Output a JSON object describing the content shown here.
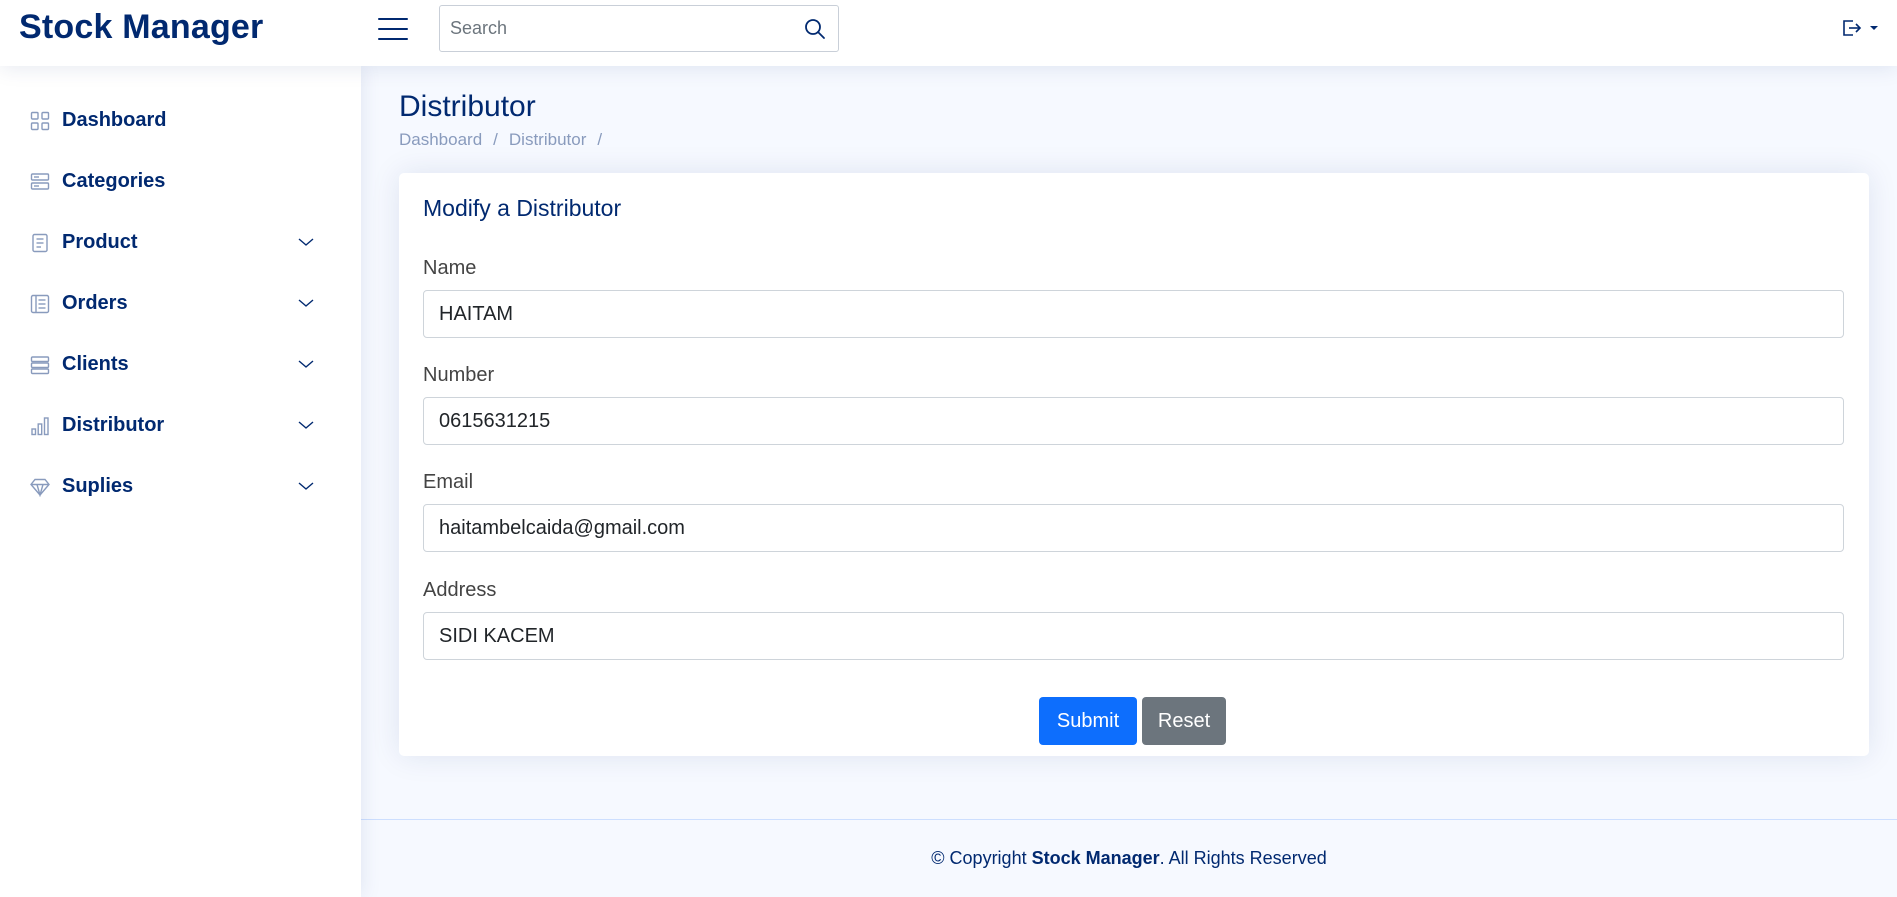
{
  "header": {
    "logo": "Stock Manager",
    "search_placeholder": "Search"
  },
  "sidebar": {
    "items": [
      {
        "label": "Dashboard",
        "icon": "grid-icon",
        "has_chevron": false
      },
      {
        "label": "Categories",
        "icon": "stack-icon",
        "has_chevron": false
      },
      {
        "label": "Product",
        "icon": "journal-icon",
        "has_chevron": true
      },
      {
        "label": "Orders",
        "icon": "layout-text-icon",
        "has_chevron": true
      },
      {
        "label": "Clients",
        "icon": "server-icon",
        "has_chevron": true
      },
      {
        "label": "Distributor",
        "icon": "bar-chart-icon",
        "has_chevron": true
      },
      {
        "label": "Suplies",
        "icon": "gem-icon",
        "has_chevron": true
      }
    ]
  },
  "page": {
    "title": "Distributor",
    "breadcrumb": [
      "Dashboard",
      "Distributor"
    ]
  },
  "form": {
    "title": "Modify a Distributor",
    "fields": [
      {
        "label": "Name",
        "value": "HAITAM"
      },
      {
        "label": "Number",
        "value": "0615631215"
      },
      {
        "label": "Email",
        "value": "haitambelcaida@gmail.com"
      },
      {
        "label": "Address",
        "value": "SIDI KACEM"
      }
    ],
    "submit_label": "Submit",
    "reset_label": "Reset"
  },
  "footer": {
    "prefix": "© Copyright ",
    "brand": "Stock Manager",
    "suffix": ". All Rights Reserved"
  },
  "colors": {
    "brand": "#012970",
    "primary": "#0d6efd",
    "secondary": "#6c757d",
    "background": "#f6f9ff"
  }
}
